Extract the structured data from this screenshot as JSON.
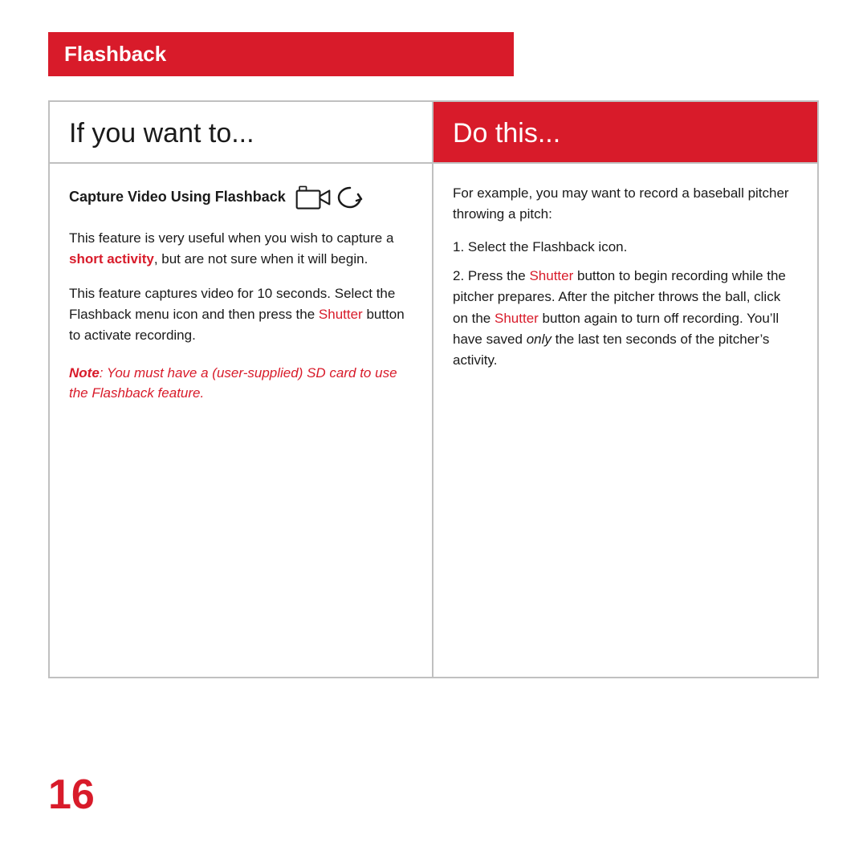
{
  "header": {
    "title": "Flashback",
    "bg_color": "#d81b2a"
  },
  "left_column": {
    "header": "If you want to...",
    "section_heading": "Capture Video Using Flashback",
    "paragraph1_pre": "This feature is very useful when you wish to capture a ",
    "paragraph1_highlight": "short activity",
    "paragraph1_post": ", but are not sure when it will begin.",
    "paragraph2_pre": "This feature captures video for 10 seconds. Select the Flashback menu icon and then press the ",
    "paragraph2_shutter": "Shutter",
    "paragraph2_post": " button to activate recording.",
    "note_label": "Note",
    "note_text": ": You must have a (user-supplied) SD card to use the Flashback feature."
  },
  "right_column": {
    "header": "Do this...",
    "example_text": "For example, you may want to record a baseball pitcher throwing a pitch:",
    "list_item1": "Select the Flashback icon.",
    "list_item2_pre": "Press the ",
    "list_item2_shutter": "Shutter",
    "list_item2_mid": " button to begin recording while the pitcher prepares. After the pitcher throws the ball, click on the ",
    "list_item2_shutter2": "Shutter",
    "list_item2_post": " button again to turn off recording. You’ll have saved ",
    "list_item2_only": "only",
    "list_item2_end": " the last ten seconds of the pitcher’s activity."
  },
  "page_number": "16"
}
